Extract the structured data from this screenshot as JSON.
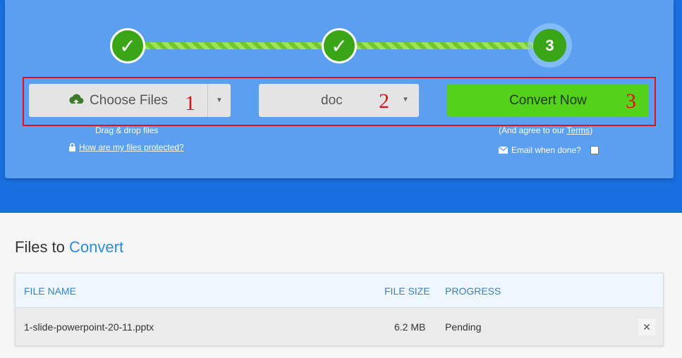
{
  "steps": [
    {
      "symbol": "✓"
    },
    {
      "symbol": "✓"
    },
    {
      "symbol": "3"
    }
  ],
  "toolbar": {
    "choose_files_label": "Choose Files",
    "format_value": "doc",
    "convert_label": "Convert Now"
  },
  "annotations": [
    "1",
    "2",
    "3"
  ],
  "drag_drop_text": "Drag & drop files",
  "protected_link": "How are my files protected?",
  "agree_prefix": "(And agree to our ",
  "terms_link": "Terms",
  "agree_suffix": ")",
  "email_label": "Email when done?",
  "files_section": {
    "title_part1": "Files to ",
    "title_part2": "Convert",
    "columns": {
      "name": "FILE NAME",
      "size": "FILE SIZE",
      "progress": "PROGRESS"
    },
    "rows": [
      {
        "name": "1-slide-powerpoint-20-11.pptx",
        "size": "6.2 MB",
        "progress": "Pending"
      }
    ]
  },
  "colors": {
    "accent_green": "#54d11a",
    "brand_blue": "#1a6fe0",
    "annotation_red": "#e01018"
  },
  "icons": {
    "upload": "cloud-upload-icon",
    "lock": "lock-icon",
    "mail": "envelope-icon",
    "remove": "close-icon"
  }
}
